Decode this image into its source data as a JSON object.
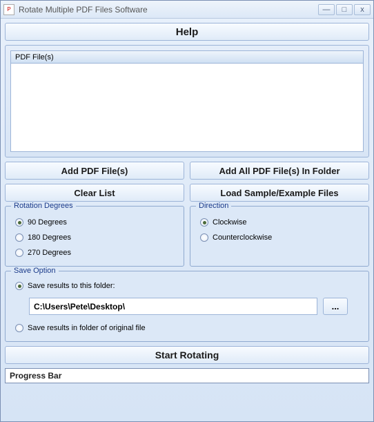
{
  "window": {
    "title": "Rotate Multiple PDF Files Software"
  },
  "help": {
    "label": "Help"
  },
  "filelist": {
    "header": "PDF File(s)"
  },
  "buttons": {
    "add_files": "Add PDF File(s)",
    "add_folder": "Add All PDF File(s) In Folder",
    "clear_list": "Clear List",
    "load_sample": "Load Sample/Example Files",
    "browse": "...",
    "start": "Start Rotating"
  },
  "rotation": {
    "legend": "Rotation Degrees",
    "options": {
      "r90": "90 Degrees",
      "r180": "180 Degrees",
      "r270": "270 Degrees"
    },
    "selected": "r90"
  },
  "direction": {
    "legend": "Direction",
    "options": {
      "cw": "Clockwise",
      "ccw": "Counterclockwise"
    },
    "selected": "cw"
  },
  "save": {
    "legend": "Save Option",
    "option_folder": "Save results to this folder:",
    "option_original": "Save results in folder of original file",
    "path": "C:\\Users\\Pete\\Desktop\\",
    "selected": "folder"
  },
  "progress": {
    "label": "Progress Bar"
  }
}
